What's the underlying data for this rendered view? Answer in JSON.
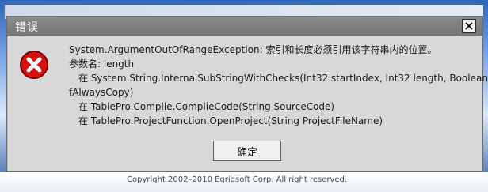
{
  "dialog": {
    "title": "错误",
    "close_label": "×",
    "icon": "error-x-icon",
    "message": [
      "System.ArgumentOutOfRangeException: 索引和长度必须引用该字符串内的位置。",
      "参数名: length",
      "在 System.String.InternalSubStringWithChecks(Int32 startIndex, Int32 length, Boolean",
      "fAlwaysCopy)",
      "在 TablePro.Complie.ComplieCode(String SourceCode)",
      "在 TablePro.ProjectFunction.OpenProject(String ProjectFileName)"
    ],
    "ok_label": "确定"
  },
  "background": {
    "footer": "Copyright 2002–2010 Egridsoft Corp. All right reserved."
  },
  "colors": {
    "dialog_bg": "#d8d8d8",
    "titlebar": "#7d7d7d",
    "error_red": "#d60f0f"
  }
}
